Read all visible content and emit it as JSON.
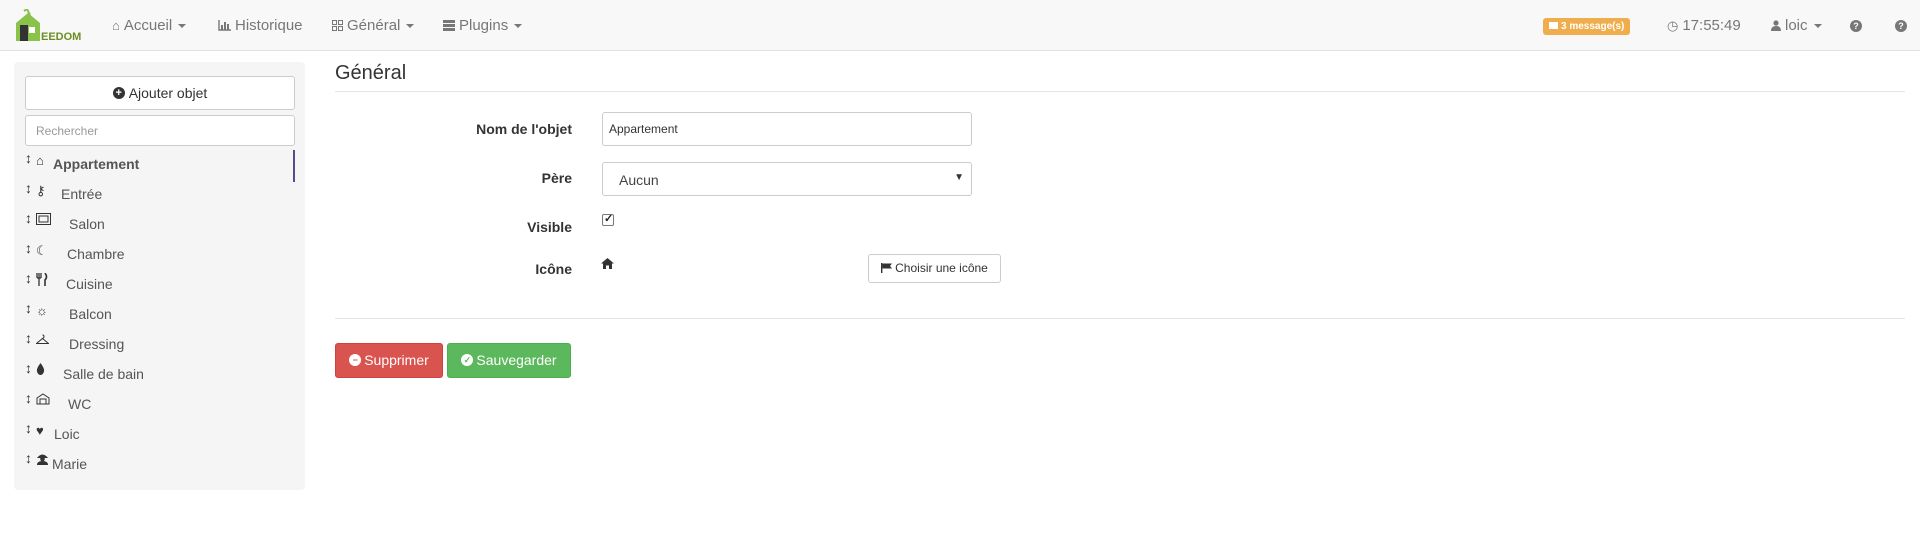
{
  "navbar": {
    "logo_text": "EEDOM",
    "items": [
      {
        "label": "Accueil",
        "icon": "home-icon"
      },
      {
        "label": "Historique",
        "icon": "bar-chart-icon"
      },
      {
        "label": "Général",
        "icon": "grid-icon"
      },
      {
        "label": "Plugins",
        "icon": "tasks-icon"
      }
    ],
    "messages": "3 message(s)",
    "time": "17:55:49",
    "user": "loic",
    "colors": {
      "badge": "#f0ad4e",
      "bg": "#f8f8f8"
    }
  },
  "sidebar": {
    "add_button": "Ajouter objet",
    "search_placeholder": "Rechercher",
    "items": [
      {
        "label": "Appartement",
        "icon": "home-icon",
        "active": true
      },
      {
        "label": "Entrée",
        "icon": "key-icon"
      },
      {
        "label": "Salon",
        "icon": "tv-icon"
      },
      {
        "label": "Chambre",
        "icon": "moon-icon"
      },
      {
        "label": "Cuisine",
        "icon": "cutlery-icon"
      },
      {
        "label": "Balcon",
        "icon": "sun-icon"
      },
      {
        "label": "Dressing",
        "icon": "hanger-icon"
      },
      {
        "label": "Salle de bain",
        "icon": "drop-icon"
      },
      {
        "label": "WC",
        "icon": "toilet-icon"
      },
      {
        "label": "Loic",
        "icon": "heart-icon"
      },
      {
        "label": "Marie",
        "icon": "user-icon"
      }
    ]
  },
  "main": {
    "title": "Général",
    "fields": {
      "name_label": "Nom de l'objet",
      "name_value": "Appartement",
      "parent_label": "Père",
      "parent_value": "Aucun",
      "visible_label": "Visible",
      "visible_checked": true,
      "icon_label": "Icône",
      "choose_icon_button": "Choisir une icône"
    },
    "delete_button": "Supprimer",
    "save_button": "Sauvegarder",
    "colors": {
      "danger": "#d9534f",
      "success": "#5cb85c"
    }
  }
}
